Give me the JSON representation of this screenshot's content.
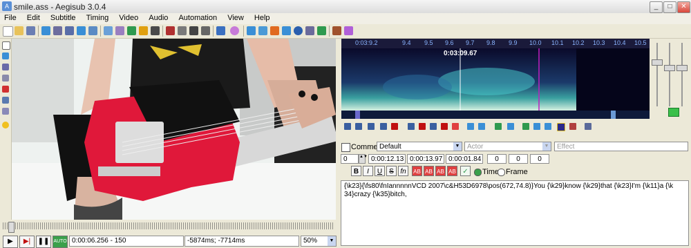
{
  "window": {
    "title": "smile.ass - Aegisub 3.0.4",
    "minimize": "_",
    "maximize": "□",
    "close": "✕"
  },
  "menu": [
    "File",
    "Edit",
    "Subtitle",
    "Timing",
    "Video",
    "Audio",
    "Automation",
    "View",
    "Help"
  ],
  "audio": {
    "ruler": [
      "0:03:9.2",
      "9.4",
      "9.5",
      "9.6",
      "9.7",
      "9.8",
      "9.9",
      "10.0",
      "10.1",
      "10.2",
      "10.3",
      "10.4",
      "10.5"
    ],
    "cursor_time": "0:03:09.67"
  },
  "video": {
    "time_field": "0:00:06.256 - 150",
    "offset_field": "-5874ms; -7714ms",
    "zoom": "50%"
  },
  "edit": {
    "comment_label": "Comment",
    "style": "Default",
    "actor_placeholder": "Actor",
    "effect_placeholder": "Effect",
    "layer": "0",
    "start": "0:00:12.13",
    "end": "0:00:13.97",
    "duration": "0:00:01.84",
    "margin_l": "0",
    "margin_r": "0",
    "margin_v": "0",
    "bold": "B",
    "italic": "I",
    "underline": "U",
    "strike": "S",
    "font": "fn",
    "color_labels": [
      "AB",
      "AB",
      "AB",
      "AB"
    ],
    "time_radio": "Time",
    "frame_radio": "Frame",
    "text_line1": "{\\k23}{\\fs80\\fnIannnnnVCD 2007\\c&H53D6978\\pos(672,74.8)}You {\\k29}know {\\k29}that {\\k23}I'm {\\k11}a {\\k",
    "text_line2": "34}crazy {\\k35}bitch,"
  },
  "colors": {
    "accent": "#3a8fd6",
    "playhead": "#c01ec0"
  }
}
